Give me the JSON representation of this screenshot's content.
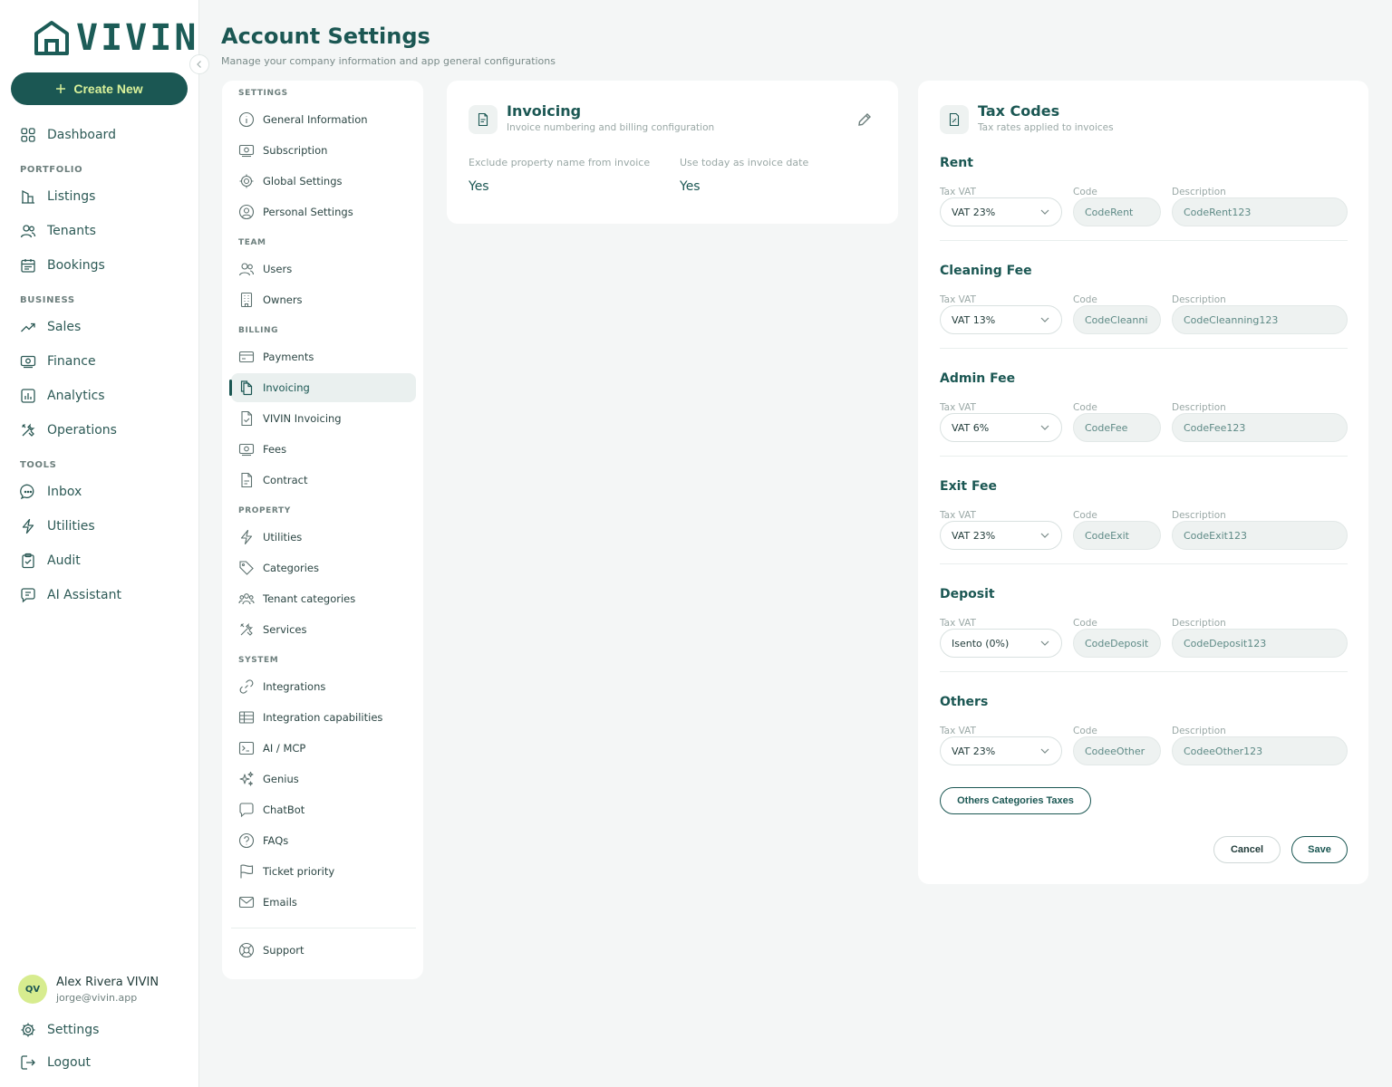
{
  "brand": {
    "name": "VIVIN",
    "create_label": "Create New"
  },
  "nav": {
    "dashboard": "Dashboard",
    "portfolio_title": "PORTFOLIO",
    "listings": "Listings",
    "tenants": "Tenants",
    "bookings": "Bookings",
    "business_title": "BUSINESS",
    "sales": "Sales",
    "finance": "Finance",
    "analytics": "Analytics",
    "operations": "Operations",
    "tools_title": "TOOLS",
    "inbox": "Inbox",
    "utilities": "Utilities",
    "audit": "Audit",
    "ai_assistant": "AI Assistant",
    "settings": "Settings",
    "logout": "Logout"
  },
  "user": {
    "initials": "QV",
    "name": "Alex Rivera VIVIN",
    "email": "jorge@vivin.app"
  },
  "header": {
    "title": "Account Settings",
    "subtitle": "Manage your company information and app general configurations"
  },
  "settings_menu": {
    "settings_title": "SETTINGS",
    "general_information": "General Information",
    "subscription": "Subscription",
    "global_settings": "Global Settings",
    "personal_settings": "Personal Settings",
    "team_title": "TEAM",
    "users": "Users",
    "owners": "Owners",
    "billing_title": "BILLING",
    "payments": "Payments",
    "invoicing": "Invoicing",
    "vivin_invoicing": "VIVIN Invoicing",
    "fees": "Fees",
    "contract": "Contract",
    "property_title": "PROPERTY",
    "utilities": "Utilities",
    "categories": "Categories",
    "tenant_categories": "Tenant categories",
    "services": "Services",
    "system_title": "SYSTEM",
    "integrations": "Integrations",
    "integration_capabilities": "Integration capabilities",
    "ai_mcp": "AI / MCP",
    "genius": "Genius",
    "chatbot": "ChatBot",
    "faqs": "FAQs",
    "ticket_priority": "Ticket priority",
    "emails": "Emails",
    "support": "Support"
  },
  "invoicing": {
    "title": "Invoicing",
    "subtitle": "Invoice numbering and billing configuration",
    "exclude_label": "Exclude property name from invoice",
    "exclude_value": "Yes",
    "today_label": "Use today as invoice date",
    "today_value": "Yes"
  },
  "tax_codes": {
    "title": "Tax Codes",
    "subtitle": "Tax rates applied to invoices",
    "label_tax": "Tax VAT",
    "label_code": "Code",
    "label_desc": "Description",
    "sections": [
      {
        "title": "Rent",
        "vat": "VAT 23%",
        "code": "CodeRent",
        "description": "CodeRent123"
      },
      {
        "title": "Cleaning Fee",
        "vat": "VAT 13%",
        "code": "CodeCleanni",
        "description": "CodeCleanning123"
      },
      {
        "title": "Admin Fee",
        "vat": "VAT 6%",
        "code": "CodeFee",
        "description": "CodeFee123"
      },
      {
        "title": "Exit Fee",
        "vat": "VAT 23%",
        "code": "CodeExit",
        "description": "CodeExit123"
      },
      {
        "title": "Deposit",
        "vat": "Isento (0%)",
        "code": "CodeDeposit",
        "description": "CodeDeposit123"
      },
      {
        "title": "Others",
        "vat": "VAT 23%",
        "code": "CodeeOther",
        "description": "CodeeOther123"
      }
    ],
    "others_categories_label": "Others Categories Taxes",
    "cancel_label": "Cancel",
    "save_label": "Save"
  }
}
